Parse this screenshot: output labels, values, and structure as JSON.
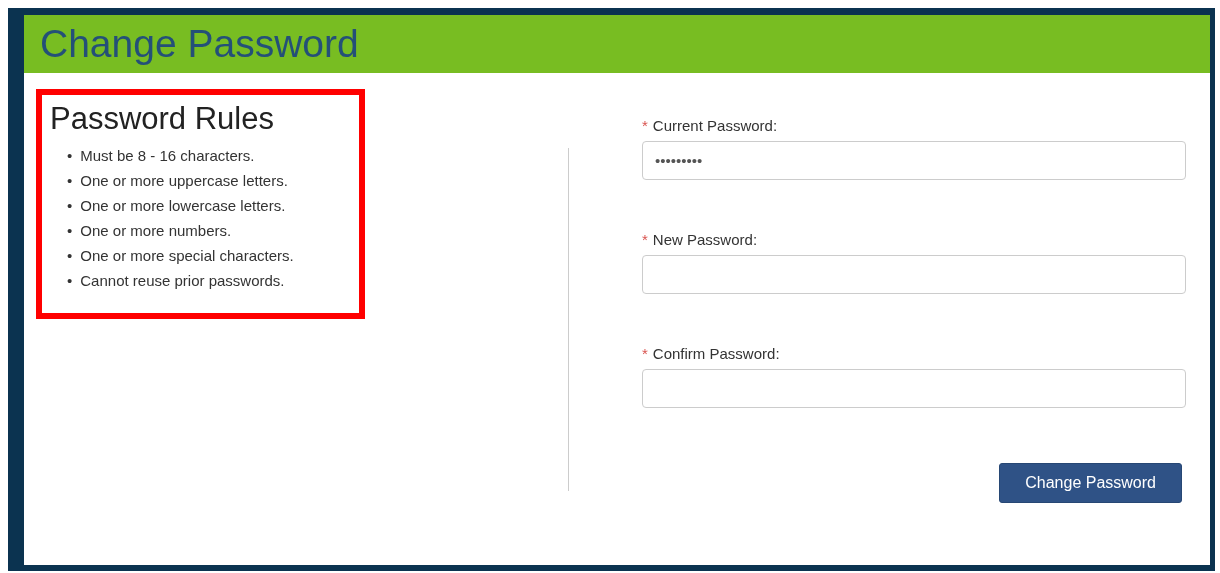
{
  "header": {
    "title": "Change Password"
  },
  "rules": {
    "title": "Password Rules",
    "items": [
      {
        "bullet": "•",
        "text": "Must be 8 - 16 characters."
      },
      {
        "bullet": "•",
        "text": "One or more uppercase letters."
      },
      {
        "bullet": "•",
        "text": "One or more lowercase letters."
      },
      {
        "bullet": "•",
        "text": "One or more numbers."
      },
      {
        "bullet": "•",
        "text": "One or more special characters."
      },
      {
        "bullet": "•",
        "text": "Cannot reuse prior passwords."
      }
    ]
  },
  "fields": [
    {
      "label": "Current Password:",
      "required_mark": "*",
      "value": "•••••••••"
    },
    {
      "label": "New Password:",
      "required_mark": "*"
    },
    {
      "label": "Confirm Password:",
      "required_mark": "*"
    }
  ],
  "submit": {
    "label": "Change Password"
  }
}
